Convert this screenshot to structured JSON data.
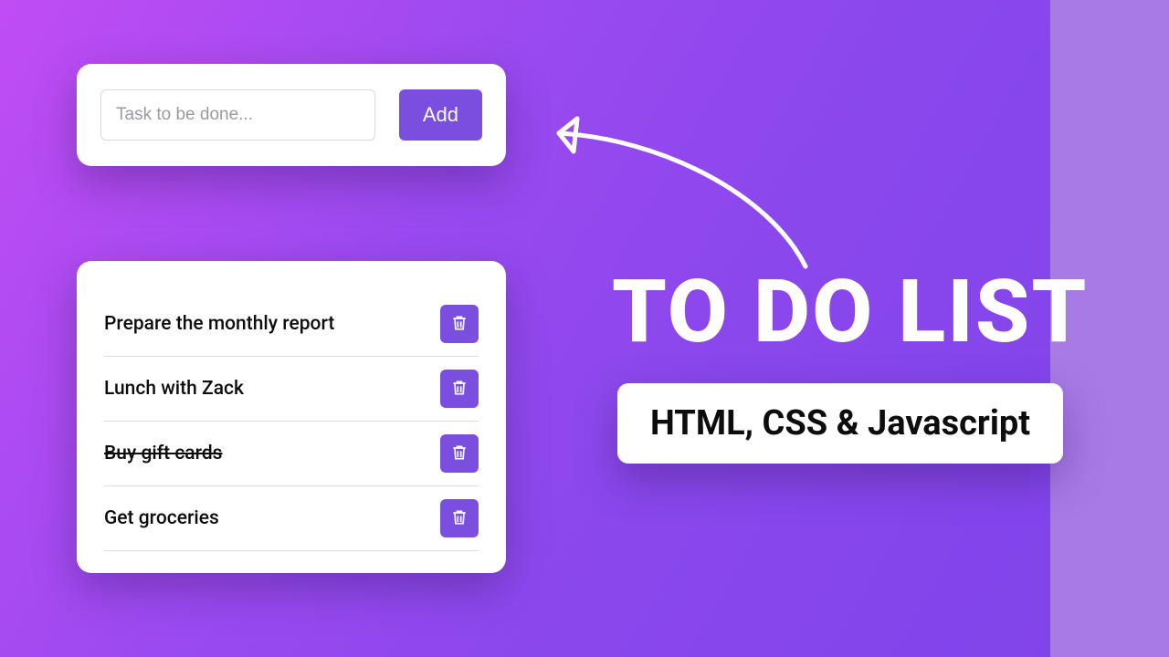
{
  "colors": {
    "accent": "#7a4fe0"
  },
  "input_card": {
    "placeholder": "Task to be done...",
    "add_label": "Add"
  },
  "todos": [
    {
      "text": "Prepare the monthly report",
      "done": false
    },
    {
      "text": "Lunch with Zack",
      "done": false
    },
    {
      "text": "Buy gift cards",
      "done": true
    },
    {
      "text": "Get groceries",
      "done": false
    }
  ],
  "headline": "TO DO LIST",
  "subheadline": "HTML, CSS & Javascript"
}
